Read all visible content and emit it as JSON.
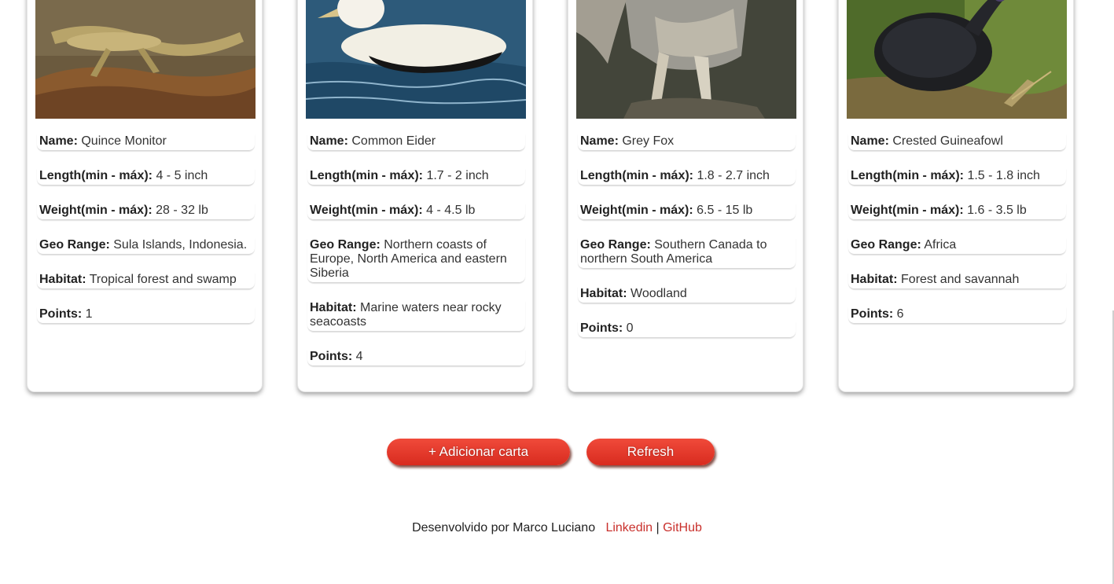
{
  "labels": {
    "name": "Name:",
    "length": "Length(min - máx):",
    "weight": "Weight(min - máx):",
    "geo": "Geo Range:",
    "habitat": "Habitat:",
    "points": "Points:"
  },
  "cards": [
    {
      "name": "Quince Monitor",
      "length": "4 - 5 inch",
      "weight": "28 - 32 lb",
      "geo": "Sula Islands, Indonesia.",
      "habitat": "Tropical forest and swamp",
      "points": "1"
    },
    {
      "name": "Common Eider",
      "length": "1.7 - 2 inch",
      "weight": "4 - 4.5 lb",
      "geo": "Northern coasts of Europe, North America and eastern Siberia",
      "habitat": "Marine waters near rocky seacoasts",
      "points": "4"
    },
    {
      "name": "Grey Fox",
      "length": "1.8 - 2.7 inch",
      "weight": "6.5 - 15 lb",
      "geo": "Southern Canada to northern South America",
      "habitat": "Woodland",
      "points": "0"
    },
    {
      "name": "Crested Guineafowl",
      "length": "1.5 - 1.8 inch",
      "weight": "1.6 - 3.5 lb",
      "geo": "Africa",
      "habitat": "Forest and savannah",
      "points": "6"
    }
  ],
  "buttons": {
    "add": "+ Adicionar carta",
    "refresh": "Refresh"
  },
  "footer": {
    "credit": "Desenvolvido por Marco Luciano",
    "linkedin": "Linkedin",
    "separator": "|",
    "github": "GitHub"
  },
  "colors": {
    "accent": "#d82b1f",
    "link": "#c9302c"
  }
}
